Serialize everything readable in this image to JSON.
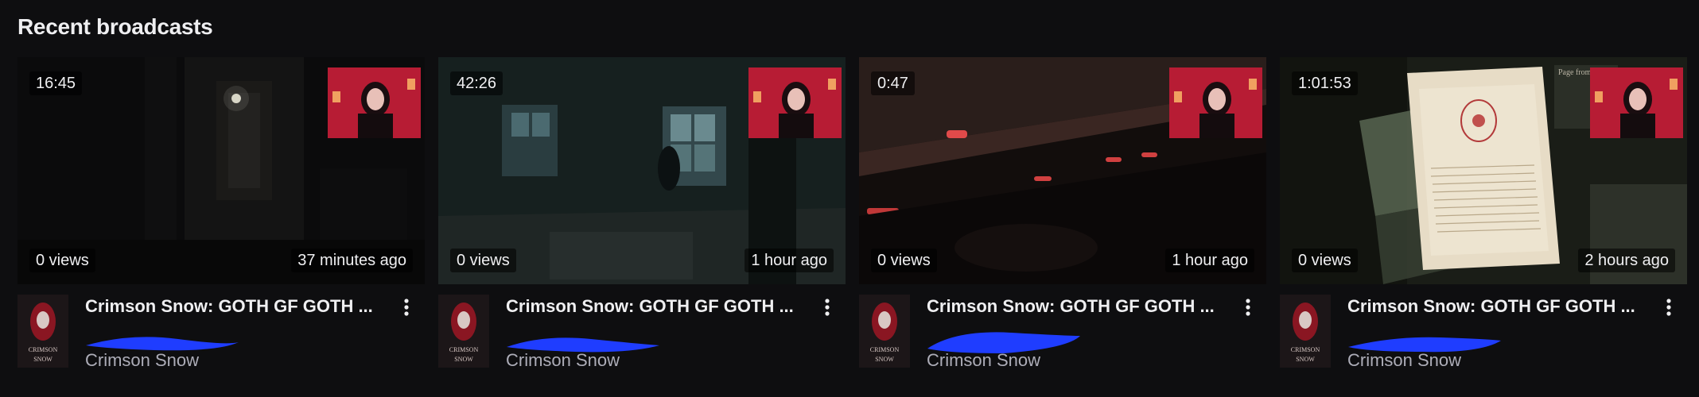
{
  "section": {
    "title": "Recent broadcasts"
  },
  "cards": [
    {
      "duration": "16:45",
      "views": "0 views",
      "age": "37 minutes ago",
      "title": "Crimson Snow: GOTH GF GOTH ...",
      "channel": "Crimson Snow",
      "more_icon": "kebab-menu-icon"
    },
    {
      "duration": "42:26",
      "views": "0 views",
      "age": "1 hour ago",
      "title": "Crimson Snow: GOTH GF GOTH ...",
      "channel": "Crimson Snow",
      "more_icon": "kebab-menu-icon"
    },
    {
      "duration": "0:47",
      "views": "0 views",
      "age": "1 hour ago",
      "title": "Crimson Snow: GOTH GF GOTH ...",
      "channel": "Crimson Snow",
      "more_icon": "kebab-menu-icon"
    },
    {
      "duration": "1:01:53",
      "views": "0 views",
      "age": "2 hours ago",
      "title": "Crimson Snow: GOTH GF GOTH ...",
      "channel": "Crimson Snow",
      "more_icon": "kebab-menu-icon"
    }
  ],
  "avatar_text": {
    "line1": "CRIMSON",
    "line2": "SNOW"
  },
  "thumbnail_text": {
    "page_heading": "Page from"
  },
  "colors": {
    "background": "#0e0e10",
    "text": "#efeff1",
    "muted": "#adadb8",
    "redaction": "#1f3dff",
    "webcam_red": "#c81e3a"
  }
}
